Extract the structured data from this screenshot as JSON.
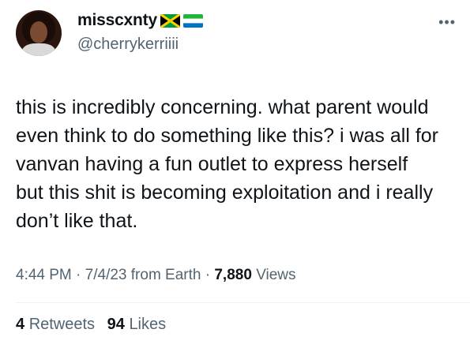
{
  "author": {
    "display_name": "misscxnty",
    "flags": [
      "jamaica-flag",
      "sierra-leone-flag"
    ],
    "handle": "@cherrykerriiii"
  },
  "tweet": {
    "text": "this is incredibly concerning. what parent would\neven think to do something like this? i was all for\nvanvan having a fun outlet to express herself\nbut this shit is becoming exploitation and i really\ndon’t like that."
  },
  "meta": {
    "time": "4:44 PM",
    "date": "7/4/23",
    "source": "from Earth",
    "views_count": "7,880",
    "views_label": "Views"
  },
  "stats": {
    "retweets_count": "4",
    "retweets_label": "Retweets",
    "likes_count": "94",
    "likes_label": "Likes"
  },
  "colors": {
    "text": "#0f1419",
    "secondary": "#536471",
    "divider": "#eff3f4"
  }
}
